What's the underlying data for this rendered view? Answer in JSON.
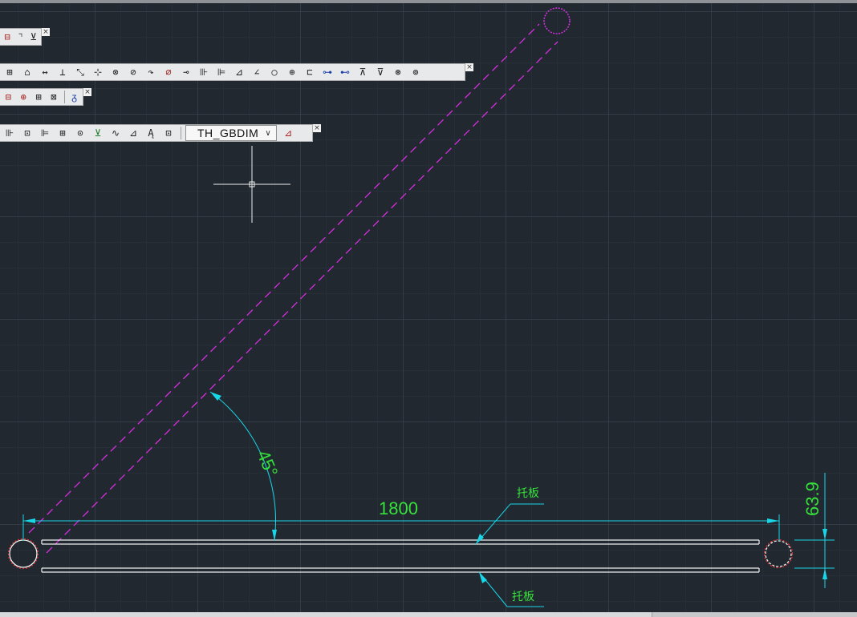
{
  "toolbars": {
    "t1": {
      "buttons": [
        "⊟",
        "⌝",
        "⊻"
      ],
      "close": "×"
    },
    "t2": {
      "buttons": [
        "⊞",
        "⌂",
        "↔",
        "⊥",
        "⤡",
        "⊹",
        "⊗",
        "⊘",
        "↷",
        "⌀",
        "⊸",
        "⊪",
        "⊫",
        "⊿",
        "∠",
        "○",
        "⊕",
        "⊏",
        "⊶",
        "⊷",
        "⊼",
        "⊽",
        "⊛",
        "⊚"
      ],
      "close": "×"
    },
    "t3": {
      "buttons": [
        "⊟",
        "⊕",
        "⊞",
        "⊠",
        "ᵹ"
      ],
      "close": "×"
    },
    "t4": {
      "buttons_left": [
        "⊪",
        "⊡",
        "⊫",
        "⊞",
        "⊙",
        "⊻",
        "∿",
        "⊿",
        "Ą",
        "⊡"
      ],
      "combo": {
        "value": "TH_GBDIM",
        "arrow": "∨"
      },
      "buttons_right": [
        "⊿"
      ],
      "close": "×"
    }
  },
  "drawing": {
    "angle_label": "45°",
    "length_label": "1800",
    "width_label": "63.9",
    "leader_top_label": "托板",
    "leader_bottom_label": "托板"
  },
  "colors": {
    "background": "#212830",
    "dimension": "#19d6e6",
    "text": "#36e23a",
    "magenta": "#d62ee0",
    "red": "#e23030",
    "white": "#f0f0f0"
  }
}
